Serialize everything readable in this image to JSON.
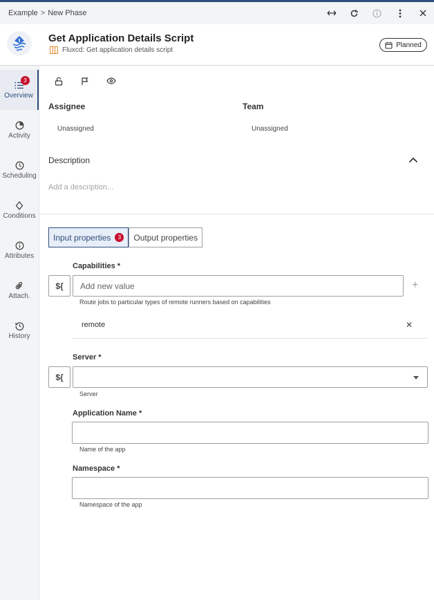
{
  "breadcrumb": {
    "parent": "Example",
    "separator": ">",
    "current": "New Phase"
  },
  "header": {
    "title": "Get Application Details Script",
    "subtitle": "Fluxcd: Get application details script",
    "status": "Planned"
  },
  "sidebar": {
    "items": [
      {
        "label": "Overview",
        "badge": "3"
      },
      {
        "label": "Activity"
      },
      {
        "label": "Scheduling"
      },
      {
        "label": "Conditions"
      },
      {
        "label": "Attributes"
      },
      {
        "label": "Attach."
      },
      {
        "label": "History"
      }
    ]
  },
  "overview": {
    "assignee_label": "Assignee",
    "assignee_value": "Unassigned",
    "team_label": "Team",
    "team_value": "Unassigned",
    "description_label": "Description",
    "description_placeholder": "Add a description..."
  },
  "tabs": {
    "input": {
      "label": "Input properties",
      "badge": "3"
    },
    "output": {
      "label": "Output properties"
    }
  },
  "fields": {
    "capabilities": {
      "label": "Capabilities *",
      "expr": "${",
      "placeholder": "Add new value",
      "helper": "Route jobs to particular types of remote runners based on capabilities",
      "chip": "remote"
    },
    "server": {
      "label": "Server *",
      "expr": "${",
      "value": "",
      "helper": "Server"
    },
    "app_name": {
      "label": "Application Name *",
      "value": "",
      "helper": "Name of the app"
    },
    "namespace": {
      "label": "Namespace *",
      "value": "",
      "helper": "Namespace of the app"
    }
  },
  "colors": {
    "accent": "#2e4d7b",
    "badge": "#c8102e",
    "task_icon": "#e08a2b"
  }
}
